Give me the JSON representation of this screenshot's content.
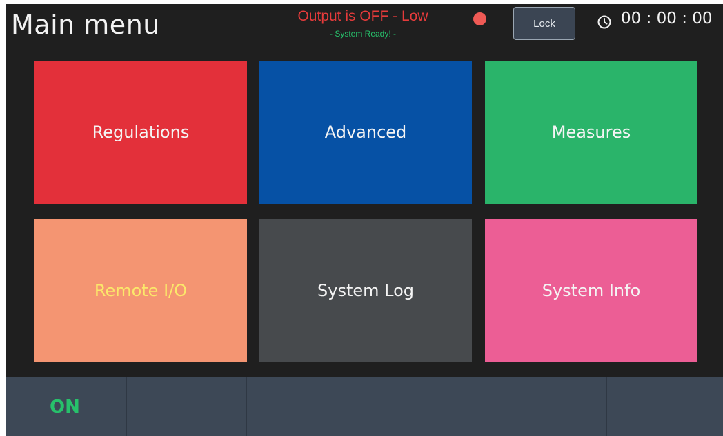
{
  "header": {
    "title": "Main menu",
    "status_main": "Output is OFF - Low",
    "status_sub": "- System Ready! -",
    "lock_label": "Lock",
    "clock_icon": "clock-icon",
    "clock_text": "00 : 00 : 00"
  },
  "colors": {
    "background": "#1f1f1f",
    "status_off": "#e53b3b",
    "status_ready": "#27c16b",
    "indicator": "#ef5a55",
    "on_label": "#27c16b",
    "bottom_bar": "#3d4856"
  },
  "tiles": [
    {
      "label": "Regulations",
      "color": "#e3303a",
      "text_color": "#f4f4f4"
    },
    {
      "label": "Advanced",
      "color": "#0651a5",
      "text_color": "#f4f4f4"
    },
    {
      "label": "Measures",
      "color": "#2ab46a",
      "text_color": "#f4f4f4"
    },
    {
      "label": "Remote I/O",
      "color": "#f49572",
      "text_color": "#fbe86a"
    },
    {
      "label": "System Log",
      "color": "#474a4d",
      "text_color": "#f4f4f4"
    },
    {
      "label": "System Info",
      "color": "#ec5e95",
      "text_color": "#f4f4f4"
    }
  ],
  "bottom_bar": {
    "items": [
      "ON",
      "",
      "",
      "",
      "",
      ""
    ]
  }
}
